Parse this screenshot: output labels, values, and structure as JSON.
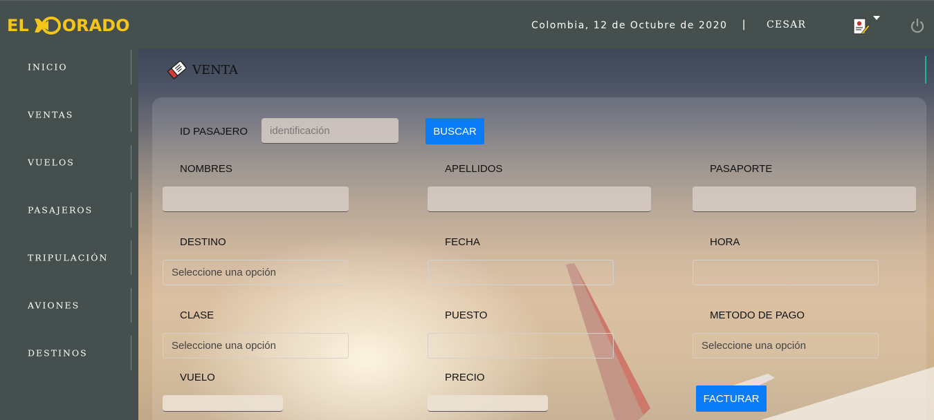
{
  "header": {
    "logo_left": "EL",
    "logo_right": "ORADO",
    "date": "Colombia, 12 de Octubre de 2020",
    "separator": "|",
    "user": "CESAR"
  },
  "sidebar": {
    "items": [
      {
        "label": "INICIO"
      },
      {
        "label": "VENTAS"
      },
      {
        "label": "VUELOS"
      },
      {
        "label": "PASAJEROS"
      },
      {
        "label": "TRIPULACIÓN"
      },
      {
        "label": "AVIONES"
      },
      {
        "label": "DESTINOS"
      }
    ]
  },
  "page": {
    "title": "VENTA"
  },
  "form": {
    "id_label": "ID PASAJERO",
    "id_placeholder": "identificación",
    "search_button": "BUSCAR",
    "nombres_label": "NOMBRES",
    "apellidos_label": "APELLIDOS",
    "pasaporte_label": "PASAPORTE",
    "destino_label": "DESTINO",
    "destino_value": "Seleccione una opción",
    "fecha_label": "FECHA",
    "hora_label": "HORA",
    "clase_label": "CLASE",
    "clase_value": "Seleccione una opción",
    "puesto_label": "PUESTO",
    "metodo_label": "METODO DE PAGO",
    "metodo_value": "Seleccione una opción",
    "vuelo_label": "VUELO",
    "precio_label": "PRECIO",
    "invoice_button": "FACTURAR"
  },
  "colors": {
    "logo": "#f6c51a",
    "accent": "#1fb39a",
    "button": "#0a7cf8",
    "header_bg": "#454f4d"
  },
  "icons": {
    "logo_plane": "plane-icon",
    "user_menu": "document-edit-icon",
    "dropdown": "caret-down-icon",
    "logout": "power-icon",
    "title": "ticket-icon"
  }
}
